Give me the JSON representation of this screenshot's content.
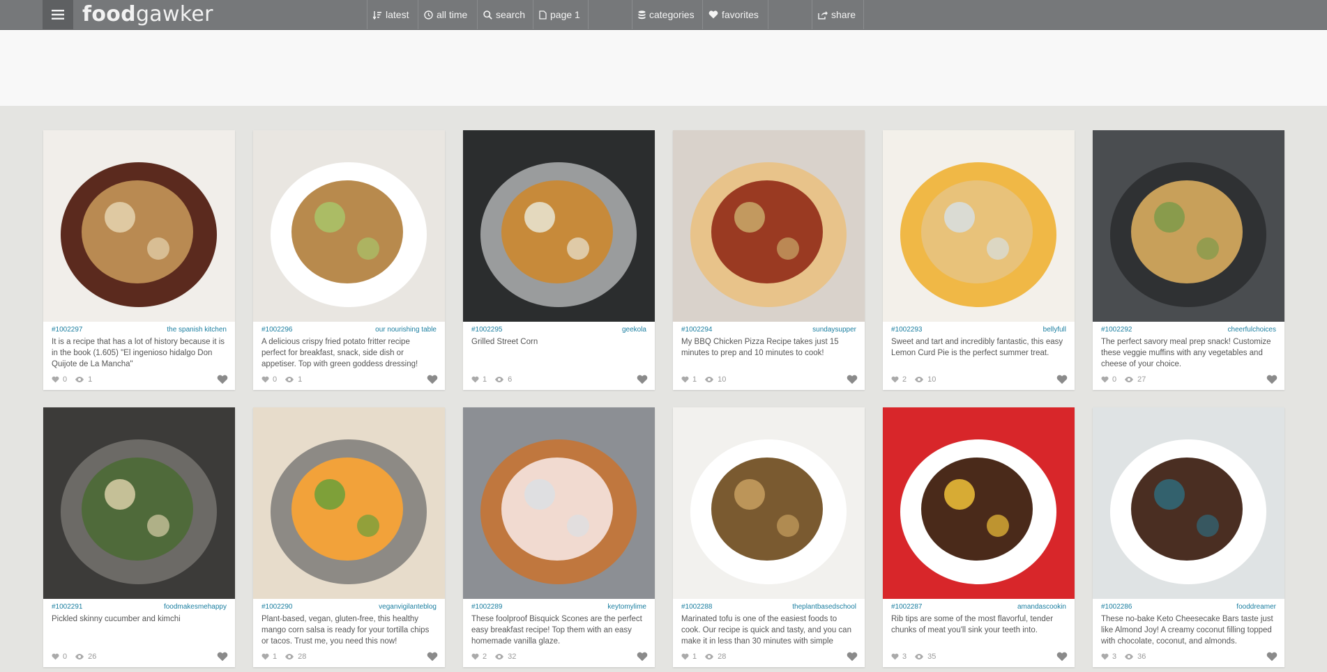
{
  "header": {
    "logo_bold": "food",
    "logo_light": "gawker",
    "nav": {
      "latest": "latest",
      "all_time": "all time",
      "search": "search",
      "page": "page 1",
      "categories": "categories",
      "favorites": "favorites",
      "share": "share"
    }
  },
  "cards": [
    {
      "id": "#1002297",
      "source": "the spanish kitchen",
      "desc": "It is a recipe that has a lot of history because it is in the book (1.605) \"El ingenioso hidalgo Don Quijote de La Mancha\"",
      "likes": "0",
      "views": "1",
      "palette": [
        "#f1eeea",
        "#5b2a1e",
        "#b98a52",
        "#e5d4b0"
      ]
    },
    {
      "id": "#1002296",
      "source": "our nourishing table",
      "desc": "A delicious crispy fried potato fritter recipe perfect for breakfast, snack, side dish or appetiser. Top with green goddess dressing!",
      "likes": "0",
      "views": "1",
      "palette": [
        "#e9e6e1",
        "#ffffff",
        "#b88a4d",
        "#a8c46a"
      ]
    },
    {
      "id": "#1002295",
      "source": "geekola",
      "desc": "Grilled Street Corn",
      "likes": "1",
      "views": "6",
      "palette": [
        "#2b2d2e",
        "#9a9c9d",
        "#c78a3a",
        "#e9e6d6"
      ]
    },
    {
      "id": "#1002294",
      "source": "sundaysupper",
      "desc": "My BBQ Chicken Pizza Recipe takes just 15 minutes to prep and 10 minutes to cook!",
      "likes": "1",
      "views": "10",
      "palette": [
        "#d9d2cb",
        "#e8c38a",
        "#9a3a22",
        "#c9aa6a"
      ]
    },
    {
      "id": "#1002293",
      "source": "bellyfull",
      "desc": "Sweet and tart and incredibly fantastic, this easy Lemon Curd Pie is the perfect summer treat.",
      "likes": "2",
      "views": "10",
      "palette": [
        "#f3f0ea",
        "#f0b846",
        "#e8c27a",
        "#d7dfe3"
      ]
    },
    {
      "id": "#1002292",
      "source": "cheerfulchoices",
      "desc": "The perfect savory meal prep snack! Customize these veggie muffins with any vegetables and cheese of your choice.",
      "likes": "0",
      "views": "27",
      "palette": [
        "#4a4d50",
        "#2f3133",
        "#c8a05a",
        "#7e9a4a"
      ]
    },
    {
      "id": "#1002291",
      "source": "foodmakesmehappy",
      "desc": "Pickled skinny cucumber and kimchi",
      "likes": "0",
      "views": "26",
      "palette": [
        "#3c3b39",
        "#6c6a66",
        "#4f6a3a",
        "#d9cfa8"
      ]
    },
    {
      "id": "#1002290",
      "source": "veganvigilanteblog",
      "desc": "Plant-based, vegan, gluten-free, this healthy mango corn salsa is ready for your tortilla chips or tacos. Trust me, you need this now!",
      "likes": "1",
      "views": "28",
      "palette": [
        "#e7dccb",
        "#8d8a85",
        "#f2a23a",
        "#6aa03a"
      ]
    },
    {
      "id": "#1002289",
      "source": "keytomylime",
      "desc": "These foolproof Bisquick Scones are the perfect easy breakfast recipe! Top them with an easy homemade vanilla glaze.",
      "likes": "2",
      "views": "32",
      "palette": [
        "#8c8f94",
        "#c0773e",
        "#f1dad0",
        "#dcdfe4"
      ]
    },
    {
      "id": "#1002288",
      "source": "theplantbasedschool",
      "desc": "Marinated tofu is one of the easiest foods to cook. Our recipe is quick and tasty, and you can make it in less than 30 minutes with simple",
      "likes": "1",
      "views": "28",
      "palette": [
        "#f2f1ee",
        "#ffffff",
        "#7a5a30",
        "#c8a060"
      ]
    },
    {
      "id": "#1002287",
      "source": "amandascookin",
      "desc": "Rib tips are some of the most flavorful, tender chunks of meat you'll sink your teeth into.",
      "likes": "3",
      "views": "35",
      "palette": [
        "#d8262a",
        "#ffffff",
        "#4a2a1a",
        "#f0c23a"
      ]
    },
    {
      "id": "#1002286",
      "source": "fooddreamer",
      "desc": "These no-bake Keto Cheesecake Bars taste just like Almond Joy! A creamy coconut filling topped with chocolate, coconut, and almonds.",
      "likes": "3",
      "views": "36",
      "palette": [
        "#dfe3e4",
        "#ffffff",
        "#4a2e22",
        "#2f6a7a"
      ]
    }
  ]
}
